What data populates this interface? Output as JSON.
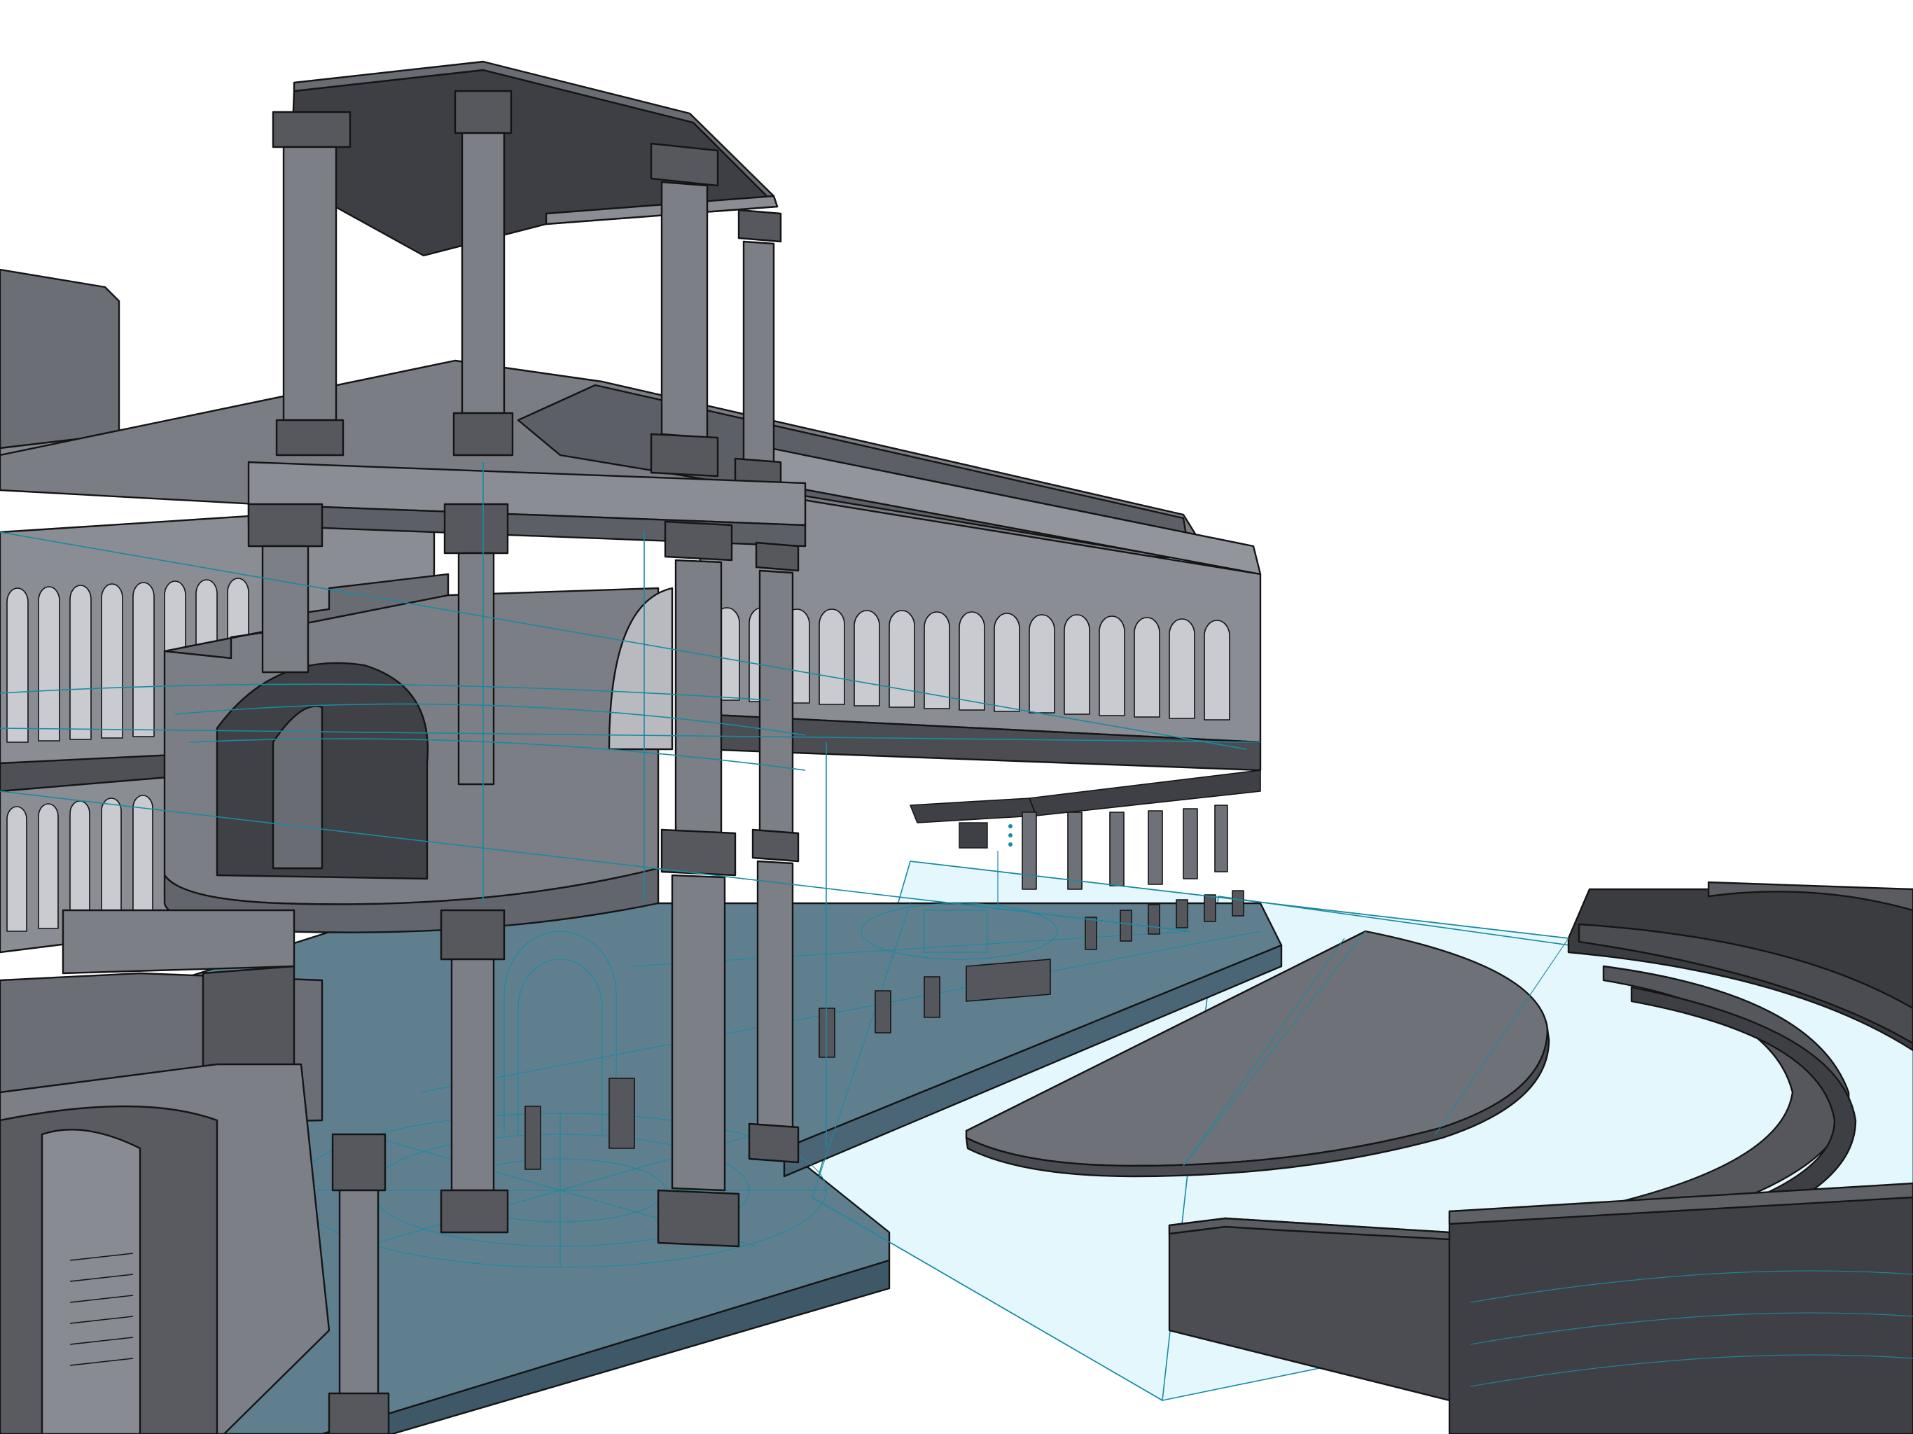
{
  "viewport": {
    "background": "#ffffff",
    "render_style": "shaded-with-edges",
    "section_plane": "visible"
  },
  "colors": {
    "model_light": "#8d8f96",
    "model_mid": "#6f7178",
    "model_dark": "#55575d",
    "model_darkest": "#2f3034",
    "edge": "#141414",
    "section_fill_light": "#e3f7fc",
    "section_fill_dark": "#5f7f8f",
    "section_line": "#1a8aa0"
  },
  "model": {
    "elements": [
      "canopy-roof",
      "canopy-columns",
      "upper-arcade",
      "lower-arcade",
      "stair-tower",
      "section-plane",
      "stage-platform",
      "orchestra-disc",
      "seating-tiers",
      "cutaway-stair"
    ]
  }
}
